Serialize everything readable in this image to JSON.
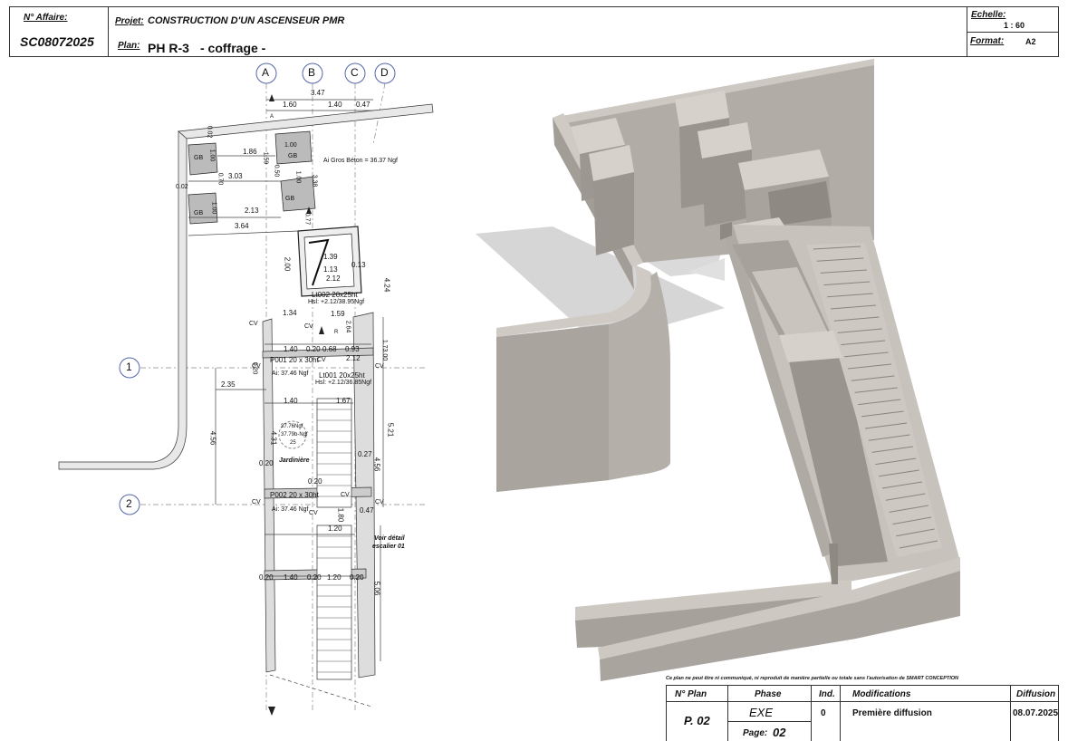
{
  "header": {
    "affaire_label": "N° Affaire:",
    "affaire_value": "SC08072025",
    "projet_label": "Projet:",
    "projet_value": "CONSTRUCTION D'UN ASCENSEUR PMR",
    "plan_label": "Plan:",
    "plan_value": "PH R-3",
    "plan_subtitle": "- coffrage -",
    "echelle_label": "Echelle:",
    "echelle_value": "1 : 60",
    "format_label": "Format:",
    "format_value": "A2"
  },
  "plan": {
    "axes_letters": [
      "A",
      "B",
      "C",
      "D"
    ],
    "axes_numbers": [
      "1",
      "2"
    ],
    "dims": {
      "total_top": "3.47",
      "d160": "1.60",
      "d140": "1.40",
      "d047": "0.47",
      "d186": "1.86",
      "d303": "3.03",
      "d213": "2.13",
      "d364": "3.64",
      "d002a": "0.02",
      "d002b": "0.02",
      "d100a": "1.00",
      "d100b": "1.00",
      "d100c": "1.00",
      "d100d": "1.00",
      "d070": "0.70",
      "d159": "1.59",
      "d338": "3.38",
      "d050": "0.50",
      "d077": "0.77",
      "d139": "1.39",
      "d113a": "1.13",
      "d212a": "2.12",
      "d200": "2.00",
      "d113b": "0.13",
      "d424": "4.24",
      "d134": "1.34",
      "d159b": "1.59",
      "d264": "2.64",
      "d140b": "1.40",
      "d020a": "0.20",
      "d068": "0.68",
      "d093": "0.93",
      "d212b": "2.12",
      "d020b": "0.20",
      "d235": "2.35",
      "d140c": "1.40",
      "d167": "1.67",
      "d456a": "4.56",
      "d431": "4.31",
      "d456b": "4.56",
      "d521": "5.21",
      "d027": "0.27",
      "d020c": "0.20",
      "d020d": "0.20",
      "d120a": "1.20",
      "d180": "1.80",
      "d047b": "0.47",
      "d020e": "0.20",
      "d140d": "1.40",
      "d020f": "0.20",
      "d120b": "1.20",
      "d020g": "0.20",
      "d506": "5.06",
      "d1730": "1.73.00"
    },
    "gb": "GB",
    "ai_gros_beton": "Ai Gros Béton = 36.37 Ngf",
    "lt002": "Lt002 20x25ht",
    "lt002_hsl": "Hsl: +2.12/38.95Ngf",
    "lt001": "Lt001 20x25ht",
    "lt001_hsl": "Hsl: +2.12/36.85Ngf",
    "p001": "P001 20 x 30ht",
    "p002": "P002 20 x 30ht",
    "ai1": "Ai: 37.46 Ngf",
    "ai2": "Ai: 37.46 Ngf",
    "cv": "CV",
    "jardiniere": "Jardinière",
    "level1": "37.76Ngf",
    "level2": "37.79b-Ngf",
    "level3": "25",
    "voir_detail": "Voir détail",
    "escalier": "escalier 01",
    "arrow_a": "A",
    "arrow_r": "R"
  },
  "cartouche": {
    "disclaimer": "Ce plan ne peut être ni communiqué, ni reproduit de manière partielle ou totale sans l'autorisation de SMART CONCEPTION",
    "col_nplan": "N° Plan",
    "col_phase": "Phase",
    "col_ind": "Ind.",
    "col_modifications": "Modifications",
    "col_diffusion": "Diffusion",
    "nplan_value": "P. 02",
    "phase_value": "EXE",
    "page_label": "Page:",
    "page_value": "02",
    "ind_value": "0",
    "modif_value": "Première diffusion",
    "diffusion_value": "08.07.2025"
  }
}
